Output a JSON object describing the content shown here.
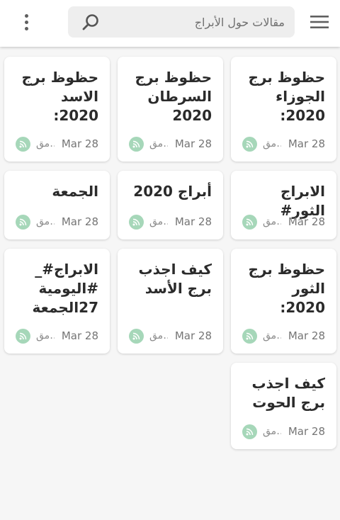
{
  "topbar": {
    "search_placeholder": "مقالات حول الأبراج",
    "icons": {
      "menu": "menu-icon",
      "search": "search-icon",
      "overflow": "more-vert-icon"
    }
  },
  "colors": {
    "source_badge": "#a6d7b9",
    "title": "#2b2b2b",
    "date": "#757575"
  },
  "cards": [
    {
      "title": "حظوظ برج الجوزاء 2020:",
      "date": "Mar 28",
      "source": "مق…"
    },
    {
      "title": "حظوظ برج السرطان 2020",
      "date": "Mar 28",
      "source": "مق…"
    },
    {
      "title": "حظوظ برج الاسد 2020:",
      "date": "Mar 28",
      "source": "مق…"
    },
    {
      "title": "الابراج الثور#",
      "date": "Mar 28",
      "source": "مق…"
    },
    {
      "title": "أبراج 2020",
      "date": "Mar 28",
      "source": "مق…"
    },
    {
      "title": "الجمعة",
      "date": "Mar 28",
      "source": "مق…"
    },
    {
      "title": "حظوظ برج الثور 2020:",
      "date": "Mar 28",
      "source": "مق…"
    },
    {
      "title": "كيف اجذب برج الأسد",
      "date": "Mar 28",
      "source": "مق…"
    },
    {
      "title": "الابراج#_ #اليومية 27الجمعة",
      "date": "Mar 28",
      "source": "مق…"
    },
    {
      "title": "كيف اجذب برج الحوت",
      "date": "Mar 28",
      "source": "مق…"
    }
  ]
}
